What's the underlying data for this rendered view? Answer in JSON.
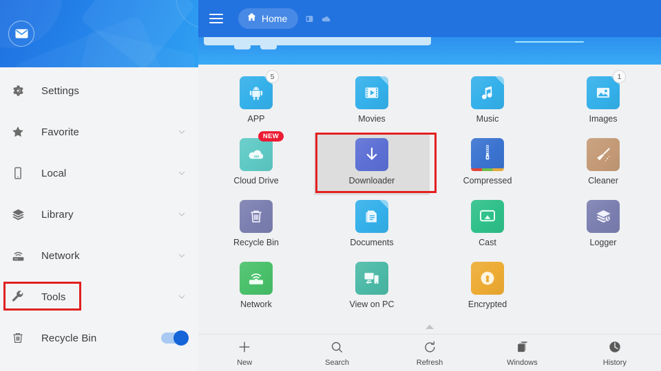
{
  "sidebar": {
    "avatar_icon": "envelope-icon",
    "items": [
      {
        "label": "Settings",
        "icon": "gear-icon",
        "accessory": "none"
      },
      {
        "label": "Favorite",
        "icon": "star-icon",
        "accessory": "chevron"
      },
      {
        "label": "Local",
        "icon": "phone-icon",
        "accessory": "chevron"
      },
      {
        "label": "Library",
        "icon": "layers-icon",
        "accessory": "chevron"
      },
      {
        "label": "Network",
        "icon": "router-icon",
        "accessory": "chevron"
      },
      {
        "label": "Tools",
        "icon": "wrench-icon",
        "accessory": "chevron",
        "highlighted": true
      },
      {
        "label": "Recycle Bin",
        "icon": "trash-icon",
        "accessory": "toggle",
        "toggle_on": true
      }
    ]
  },
  "topbar": {
    "menu_icon": "hamburger-icon",
    "breadcrumb": {
      "home_icon": "home-icon",
      "label": "Home"
    },
    "mini_icons": [
      "sdcard-icon",
      "cloud-icon"
    ]
  },
  "grid": {
    "rows": [
      [
        {
          "label": "APP",
          "icon": "android-icon",
          "color": "#34b0ea",
          "badge": "5",
          "badge_type": "num",
          "fold": true
        },
        {
          "label": "Movies",
          "icon": "video-file-icon",
          "color": "#34b0ea",
          "fold": true
        },
        {
          "label": "Music",
          "icon": "music-file-icon",
          "color": "#34b0ea",
          "fold": true
        },
        {
          "label": "Images",
          "icon": "image-file-icon",
          "color": "#34b0ea",
          "badge": "1",
          "badge_type": "num",
          "fold": true
        }
      ],
      [
        {
          "label": "Cloud Drive",
          "icon": "cloud-drive-icon",
          "color": "#5ec9c4",
          "badge": "NEW",
          "badge_type": "new"
        },
        {
          "label": "Downloader",
          "icon": "download-icon",
          "color": "#5c6fd4",
          "selected": true,
          "highlighted": true
        },
        {
          "label": "Compressed",
          "icon": "zip-icon",
          "color": "#3a73d0"
        },
        {
          "label": "Cleaner",
          "icon": "broom-icon",
          "color": "#c49a76"
        }
      ],
      [
        {
          "label": "Recycle Bin",
          "icon": "trash-tile-icon",
          "color": "#7b7fb0"
        },
        {
          "label": "Documents",
          "icon": "doc-file-icon",
          "color": "#34b0ea",
          "fold": true
        },
        {
          "label": "Cast",
          "icon": "cast-icon",
          "color": "#2fc08a"
        },
        {
          "label": "Logger",
          "icon": "logger-icon",
          "color": "#7b7fb0"
        }
      ],
      [
        {
          "label": "Network",
          "icon": "router-tile-icon",
          "color": "#49c06a"
        },
        {
          "label": "View on PC",
          "icon": "view-on-pc-icon",
          "color": "#4cb9a6"
        },
        {
          "label": "Encrypted",
          "icon": "lock-icon",
          "color": "#edab33"
        },
        {
          "label": "",
          "icon": "",
          "empty": true
        }
      ]
    ]
  },
  "bottombar": {
    "items": [
      {
        "label": "New",
        "icon": "plus-icon"
      },
      {
        "label": "Search",
        "icon": "search-icon"
      },
      {
        "label": "Refresh",
        "icon": "refresh-icon"
      },
      {
        "label": "Windows",
        "icon": "windows-icon"
      },
      {
        "label": "History",
        "icon": "history-icon"
      }
    ],
    "collapse_icon": "chevron-up-icon"
  },
  "colors": {
    "accent": "#2272e0",
    "highlight": "#e32020",
    "sidebar_bg": "#f3f4f6",
    "grid_bg": "#f0f1f3"
  }
}
